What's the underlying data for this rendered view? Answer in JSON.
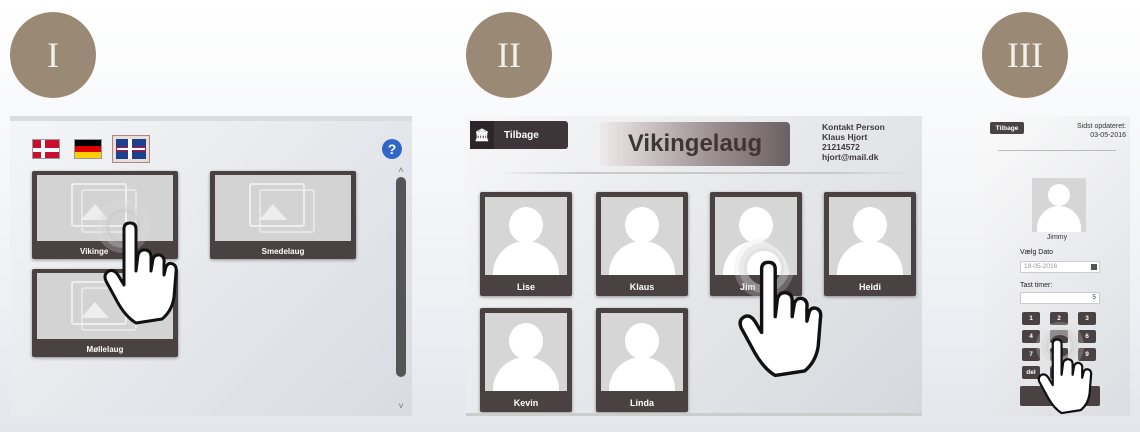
{
  "steps": [
    "I",
    "II",
    "III"
  ],
  "panel1": {
    "flags": [
      "danish-flag",
      "german-flag",
      "uk-flag"
    ],
    "help_label": "?",
    "guilds": [
      "Vikingelaug",
      "Smedelaug",
      "Møllelaug"
    ],
    "guild_visible_text": "Vikinge"
  },
  "panel2": {
    "back_label": "Tilbage",
    "title": "Vikingelaug",
    "contact": {
      "heading": "Kontakt Person",
      "name": "Klaus Hjort",
      "phone": "21214572",
      "email": "hjort@mail.dk"
    },
    "members": [
      "Lise",
      "Klaus",
      "Jimmy",
      "Heidi",
      "Kevin",
      "Linda"
    ],
    "members_visible": [
      "Lise",
      "Klaus",
      "Jim",
      "Heidi",
      "Kevin",
      "Linda"
    ]
  },
  "panel3": {
    "back_label": "Tilbage",
    "updated_label": "Sidst opdateret:",
    "updated_date": "03-05-2016",
    "name": "Jimmy",
    "date_label": "Vælg Dato",
    "date_value": "18-05-2016",
    "hours_label": "Tast timer:",
    "hours_value": "5",
    "keys": [
      "1",
      "2",
      "3",
      "4",
      "5",
      "6",
      "7",
      "8",
      "9",
      "del",
      "0"
    ],
    "keys_visible": [
      "1",
      "2",
      "3",
      "4",
      "",
      "6",
      "7",
      "",
      "9",
      "del",
      ""
    ],
    "go_label": "Go",
    "go_visible": "Go"
  },
  "colors": {
    "step_circle": "#9a8a75",
    "tile_dark": "#4a4143",
    "help_blue": "#3266c9"
  }
}
